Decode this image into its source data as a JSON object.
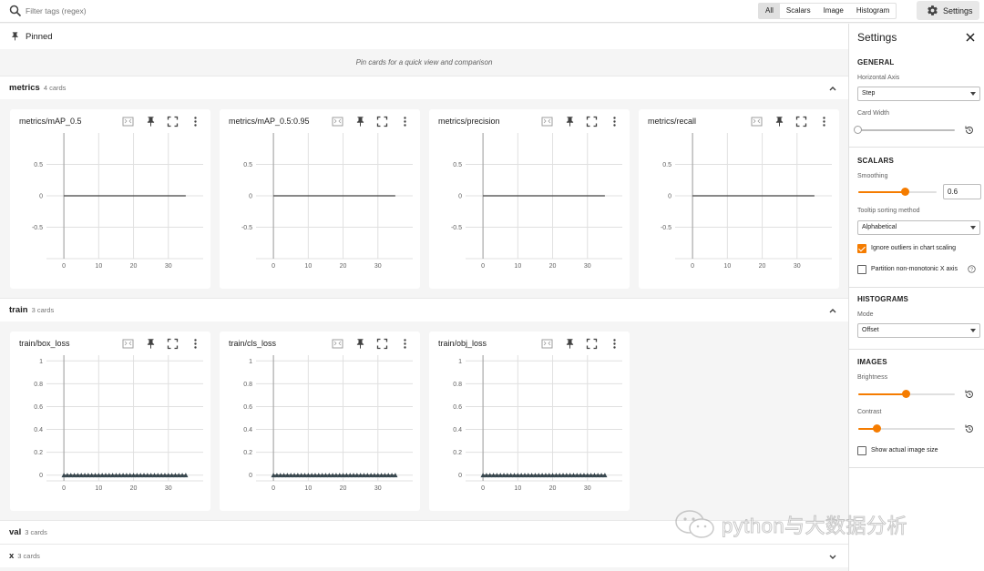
{
  "topbar": {
    "filter_placeholder": "Filter tags (regex)",
    "type_tabs": [
      "All",
      "Scalars",
      "Image",
      "Histogram"
    ],
    "active_tab": "All",
    "settings_label": "Settings"
  },
  "pinned": {
    "label": "Pinned",
    "empty_text": "Pin cards for a quick view and comparison"
  },
  "groups": [
    {
      "name": "metrics",
      "count": "4 cards",
      "expanded": true,
      "cards": [
        {
          "title": "metrics/mAP_0.5"
        },
        {
          "title": "metrics/mAP_0.5:0.95"
        },
        {
          "title": "metrics/precision"
        },
        {
          "title": "metrics/recall"
        }
      ]
    },
    {
      "name": "train",
      "count": "3 cards",
      "expanded": true,
      "cards": [
        {
          "title": "train/box_loss"
        },
        {
          "title": "train/cls_loss"
        },
        {
          "title": "train/obj_loss"
        }
      ]
    },
    {
      "name": "val",
      "count": "3 cards",
      "expanded": false
    },
    {
      "name": "x",
      "count": "3 cards",
      "expanded": false
    }
  ],
  "chart_data": [
    {
      "type": "line",
      "title": "metrics/mAP_0.5",
      "x": [
        0,
        35
      ],
      "y": [
        0,
        0
      ],
      "xlim": [
        -5,
        40
      ],
      "ylim": [
        -1,
        1
      ],
      "xticks": [
        "0",
        "10",
        "20",
        "30"
      ],
      "yticks": [
        "0.5",
        "0",
        "-0.5"
      ],
      "grid": true,
      "markers": false
    },
    {
      "type": "line",
      "title": "metrics/mAP_0.5:0.95",
      "x": [
        0,
        35
      ],
      "y": [
        0,
        0
      ],
      "xlim": [
        -5,
        40
      ],
      "ylim": [
        -1,
        1
      ],
      "xticks": [
        "0",
        "10",
        "20",
        "30"
      ],
      "yticks": [
        "0.5",
        "0",
        "-0.5"
      ],
      "grid": true,
      "markers": false
    },
    {
      "type": "line",
      "title": "metrics/precision",
      "x": [
        0,
        35
      ],
      "y": [
        0,
        0
      ],
      "xlim": [
        -5,
        40
      ],
      "ylim": [
        -1,
        1
      ],
      "xticks": [
        "0",
        "10",
        "20",
        "30"
      ],
      "yticks": [
        "0.5",
        "0",
        "-0.5"
      ],
      "grid": true,
      "markers": false
    },
    {
      "type": "line",
      "title": "metrics/recall",
      "x": [
        0,
        35
      ],
      "y": [
        0,
        0
      ],
      "xlim": [
        -5,
        40
      ],
      "ylim": [
        -1,
        1
      ],
      "xticks": [
        "0",
        "10",
        "20",
        "30"
      ],
      "yticks": [
        "0.5",
        "0",
        "-0.5"
      ],
      "grid": true,
      "markers": false
    },
    {
      "type": "line",
      "title": "train/box_loss",
      "x": [
        0,
        1,
        2,
        3,
        4,
        5,
        6,
        7,
        8,
        9,
        10,
        11,
        12,
        13,
        14,
        15,
        16,
        17,
        18,
        19,
        20,
        21,
        22,
        23,
        24,
        25,
        26,
        27,
        28,
        29,
        30,
        31,
        32,
        33,
        34,
        35
      ],
      "y": [
        0,
        0,
        0,
        0,
        0,
        0,
        0,
        0,
        0,
        0,
        0,
        0,
        0,
        0,
        0,
        0,
        0,
        0,
        0,
        0,
        0,
        0,
        0,
        0,
        0,
        0,
        0,
        0,
        0,
        0,
        0,
        0,
        0,
        0,
        0,
        0
      ],
      "xlim": [
        -5,
        40
      ],
      "ylim": [
        -0.05,
        1.05
      ],
      "xticks": [
        "0",
        "10",
        "20",
        "30"
      ],
      "yticks": [
        "1",
        "0.8",
        "0.6",
        "0.4",
        "0.2",
        "0"
      ],
      "grid": true,
      "markers": true
    },
    {
      "type": "line",
      "title": "train/cls_loss",
      "x": [
        0,
        1,
        2,
        3,
        4,
        5,
        6,
        7,
        8,
        9,
        10,
        11,
        12,
        13,
        14,
        15,
        16,
        17,
        18,
        19,
        20,
        21,
        22,
        23,
        24,
        25,
        26,
        27,
        28,
        29,
        30,
        31,
        32,
        33,
        34,
        35
      ],
      "y": [
        0,
        0,
        0,
        0,
        0,
        0,
        0,
        0,
        0,
        0,
        0,
        0,
        0,
        0,
        0,
        0,
        0,
        0,
        0,
        0,
        0,
        0,
        0,
        0,
        0,
        0,
        0,
        0,
        0,
        0,
        0,
        0,
        0,
        0,
        0,
        0
      ],
      "xlim": [
        -5,
        40
      ],
      "ylim": [
        -0.05,
        1.05
      ],
      "xticks": [
        "0",
        "10",
        "20",
        "30"
      ],
      "yticks": [
        "1",
        "0.8",
        "0.6",
        "0.4",
        "0.2",
        "0"
      ],
      "grid": true,
      "markers": true
    },
    {
      "type": "line",
      "title": "train/obj_loss",
      "x": [
        0,
        1,
        2,
        3,
        4,
        5,
        6,
        7,
        8,
        9,
        10,
        11,
        12,
        13,
        14,
        15,
        16,
        17,
        18,
        19,
        20,
        21,
        22,
        23,
        24,
        25,
        26,
        27,
        28,
        29,
        30,
        31,
        32,
        33,
        34,
        35
      ],
      "y": [
        0,
        0,
        0,
        0,
        0,
        0,
        0,
        0,
        0,
        0,
        0,
        0,
        0,
        0,
        0,
        0,
        0,
        0,
        0,
        0,
        0,
        0,
        0,
        0,
        0,
        0,
        0,
        0,
        0,
        0,
        0,
        0,
        0,
        0,
        0,
        0
      ],
      "xlim": [
        -5,
        40
      ],
      "ylim": [
        -0.05,
        1.05
      ],
      "xticks": [
        "0",
        "10",
        "20",
        "30"
      ],
      "yticks": [
        "1",
        "0.8",
        "0.6",
        "0.4",
        "0.2",
        "0"
      ],
      "grid": true,
      "markers": true
    }
  ],
  "settings": {
    "title": "Settings",
    "general": {
      "title": "GENERAL",
      "horizontal_axis_label": "Horizontal Axis",
      "horizontal_axis_value": "Step",
      "card_width_label": "Card Width",
      "card_width_level": 0
    },
    "scalars": {
      "title": "SCALARS",
      "smoothing_label": "Smoothing",
      "smoothing_value": "0.6",
      "smoothing_level": 0.6,
      "tooltip_label": "Tooltip sorting method",
      "tooltip_value": "Alphabetical",
      "ignore_outliers_label": "Ignore outliers in chart scaling",
      "ignore_outliers_checked": true,
      "partition_label": "Partition non-monotonic X axis",
      "partition_checked": false
    },
    "histograms": {
      "title": "HISTOGRAMS",
      "mode_label": "Mode",
      "mode_value": "Offset"
    },
    "images": {
      "title": "IMAGES",
      "brightness_label": "Brightness",
      "brightness_level": 0.5,
      "contrast_label": "Contrast",
      "contrast_level": 0.2,
      "actual_size_label": "Show actual image size",
      "actual_size_checked": false
    }
  },
  "watermark": {
    "text": "python与大数据分析"
  },
  "colors": {
    "accent": "#f57c00",
    "series": "#424242",
    "marker": "#37474f",
    "grid": "#e0e0e0"
  }
}
